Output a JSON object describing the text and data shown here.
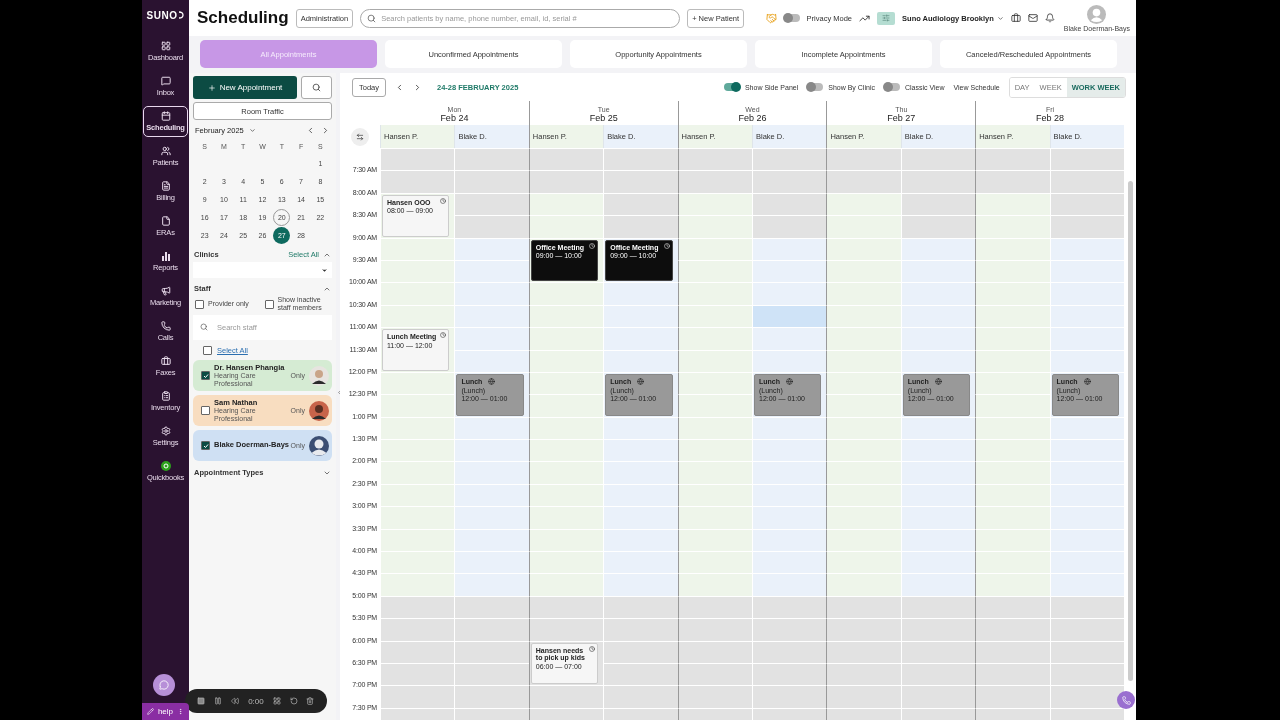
{
  "logo": "SUNO",
  "nav": [
    {
      "label": "Dashboard",
      "selected": false
    },
    {
      "label": "Inbox",
      "selected": false
    },
    {
      "label": "Scheduling",
      "selected": true
    },
    {
      "label": "Patients",
      "selected": false
    },
    {
      "label": "Billing",
      "selected": false
    },
    {
      "label": "ERAs",
      "selected": false
    },
    {
      "label": "Reports",
      "selected": false
    },
    {
      "label": "Marketing",
      "selected": false
    },
    {
      "label": "Calls",
      "selected": false
    },
    {
      "label": "Faxes",
      "selected": false
    },
    {
      "label": "Inventory",
      "selected": false
    },
    {
      "label": "Settings",
      "selected": false
    },
    {
      "label": "Quickbooks",
      "selected": false
    }
  ],
  "help": "help",
  "header": {
    "title": "Scheduling",
    "admin_button": "Administration",
    "search": {
      "placeholder": "Search patients by name, phone number, email, id, serial #"
    },
    "new_patient": "+ New Patient",
    "privacy": {
      "label": "Privacy Mode",
      "on": false
    },
    "clinic": "Suno Audiology Brooklyn",
    "user": "Blake Doerman-Bays"
  },
  "tabs": [
    {
      "label": "All Appointments",
      "selected": true
    },
    {
      "label": "Unconfirmed Appointments",
      "selected": false
    },
    {
      "label": "Opportunity Appointments",
      "selected": false
    },
    {
      "label": "Incomplete Appointments",
      "selected": false
    },
    {
      "label": "Canceled/Rescheduled Appointments",
      "selected": false
    }
  ],
  "side_panel": {
    "new_appointment": "New Appointment",
    "room_traffic": "Room Traffic",
    "mini_calendar": {
      "month": "February 2025",
      "weekdays": [
        "S",
        "M",
        "T",
        "W",
        "T",
        "F",
        "S"
      ],
      "weeks": [
        [
          {
            "label": "1",
            "today": false,
            "selected": false
          }
        ],
        [
          {
            "label": "2",
            "today": false,
            "selected": false
          },
          {
            "label": "3",
            "today": false,
            "selected": false
          },
          {
            "label": "4",
            "today": false,
            "selected": false
          },
          {
            "label": "5",
            "today": false,
            "selected": false
          },
          {
            "label": "6",
            "today": false,
            "selected": false
          },
          {
            "label": "7",
            "today": false,
            "selected": false
          },
          {
            "label": "8",
            "today": false,
            "selected": false
          }
        ],
        [
          {
            "label": "9",
            "today": false,
            "selected": false
          },
          {
            "label": "10",
            "today": false,
            "selected": false
          },
          {
            "label": "11",
            "today": false,
            "selected": false
          },
          {
            "label": "12",
            "today": false,
            "selected": false
          },
          {
            "label": "13",
            "today": false,
            "selected": false
          },
          {
            "label": "14",
            "today": false,
            "selected": false
          },
          {
            "label": "15",
            "today": false,
            "selected": false
          }
        ],
        [
          {
            "label": "16",
            "today": false,
            "selected": false
          },
          {
            "label": "17",
            "today": false,
            "selected": false
          },
          {
            "label": "18",
            "today": false,
            "selected": false
          },
          {
            "label": "19",
            "today": false,
            "selected": false
          },
          {
            "label": "20",
            "today": true,
            "selected": false
          },
          {
            "label": "21",
            "today": false,
            "selected": false
          },
          {
            "label": "22",
            "today": false,
            "selected": false
          }
        ],
        [
          {
            "label": "23",
            "today": false,
            "selected": false
          },
          {
            "label": "24",
            "today": false,
            "selected": false
          },
          {
            "label": "25",
            "today": false,
            "selected": false
          },
          {
            "label": "26",
            "today": false,
            "selected": false
          },
          {
            "label": "27",
            "today": false,
            "selected": true
          },
          {
            "label": "28",
            "today": false,
            "selected": false
          }
        ]
      ]
    },
    "clinics": {
      "label": "Clinics",
      "select_all": "Select All",
      "expanded": true
    },
    "staff": {
      "label": "Staff",
      "expanded": true,
      "filters": [
        {
          "label": "Provider only",
          "checked": false
        },
        {
          "label": "Show inactive staff members",
          "checked": false
        }
      ],
      "search": {
        "placeholder": "Search staff"
      },
      "select_all": {
        "label": "Select All",
        "checked": false
      },
      "members": [
        {
          "name": "Dr. Hansen Phangia",
          "role": "Hearing Care Professional",
          "only": "Only",
          "checked": true,
          "color": "#d5ebd3",
          "avatar": {
            "kind": "photo"
          }
        },
        {
          "name": "Sam Nathan",
          "role": "Hearing Care Professional",
          "only": "Only",
          "checked": false,
          "color": "#f8ddc0",
          "avatar": {
            "kind": "photo"
          }
        },
        {
          "name": "Blake Doerman-Bays",
          "only": "Only",
          "checked": true,
          "color": "#cfe0f3",
          "avatar": {
            "kind": "silhouette"
          }
        }
      ]
    },
    "appointment_types": {
      "label": "Appointment Types",
      "expanded": false
    }
  },
  "calendar": {
    "today": "Today",
    "range": "24-28 FEBRUARY 2025",
    "toggles": [
      {
        "label": "Show Side Panel",
        "on": true
      },
      {
        "label": "Show By Clinic",
        "on": false
      },
      {
        "label": "Classic View",
        "on": false
      }
    ],
    "view_schedule": "View Schedule",
    "views": [
      {
        "label": "DAY",
        "selected": false
      },
      {
        "label": "WEEK",
        "selected": false
      },
      {
        "label": "WORK WEEK",
        "selected": true
      }
    ],
    "days": [
      {
        "weekday": "Mon",
        "date": "Feb 24",
        "providers": [
          {
            "name": "Hansen P.",
            "color": "#eef5ea"
          },
          {
            "name": "Blake D.",
            "color": "#eaf1fa"
          }
        ]
      },
      {
        "weekday": "Tue",
        "date": "Feb 25",
        "providers": [
          {
            "name": "Hansen P.",
            "color": "#eef5ea"
          },
          {
            "name": "Blake D.",
            "color": "#eaf1fa"
          }
        ]
      },
      {
        "weekday": "Wed",
        "date": "Feb 26",
        "providers": [
          {
            "name": "Hansen P.",
            "color": "#eef5ea"
          },
          {
            "name": "Blake D.",
            "color": "#eaf1fa"
          }
        ]
      },
      {
        "weekday": "Thu",
        "date": "Feb 27",
        "providers": [
          {
            "name": "Hansen P.",
            "color": "#eef5ea"
          },
          {
            "name": "Blake D.",
            "color": "#eaf1fa"
          }
        ]
      },
      {
        "weekday": "Fri",
        "date": "Feb 28",
        "providers": [
          {
            "name": "Hansen P.",
            "color": "#eef5ea"
          },
          {
            "name": "Blake D.",
            "color": "#eaf1fa"
          }
        ]
      }
    ],
    "rows": [
      {
        "cells": [
          {
            "kind": "closed"
          },
          {
            "kind": "closed"
          },
          {
            "kind": "closed"
          },
          {
            "kind": "closed"
          },
          {
            "kind": "closed"
          },
          {
            "kind": "closed"
          },
          {
            "kind": "closed"
          },
          {
            "kind": "closed"
          },
          {
            "kind": "closed"
          },
          {
            "kind": "closed"
          }
        ]
      },
      {
        "label": "7:30 AM",
        "cells": [
          {
            "kind": "closed"
          },
          {
            "kind": "closed"
          },
          {
            "kind": "closed"
          },
          {
            "kind": "closed"
          },
          {
            "kind": "closed"
          },
          {
            "kind": "closed"
          },
          {
            "kind": "closed"
          },
          {
            "kind": "closed"
          },
          {
            "kind": "closed"
          },
          {
            "kind": "closed"
          }
        ]
      },
      {
        "label": "8:00 AM",
        "cells": [
          {
            "kind": "open",
            "event": {
              "kind": "light",
              "title": "Hansen OOO",
              "time": "08:00 — 09:00"
            }
          },
          {
            "kind": "closed"
          },
          {
            "kind": "open"
          },
          {
            "kind": "closed"
          },
          {
            "kind": "open"
          },
          {
            "kind": "closed"
          },
          {
            "kind": "open"
          },
          {
            "kind": "closed"
          },
          {
            "kind": "open"
          },
          {
            "kind": "closed"
          }
        ]
      },
      {
        "label": "8:30 AM",
        "cells": [
          {
            "kind": "open"
          },
          {
            "kind": "closed"
          },
          {
            "kind": "open"
          },
          {
            "kind": "closed"
          },
          {
            "kind": "open"
          },
          {
            "kind": "closed"
          },
          {
            "kind": "open"
          },
          {
            "kind": "closed"
          },
          {
            "kind": "open"
          },
          {
            "kind": "closed"
          }
        ]
      },
      {
        "label": "9:00 AM",
        "cells": [
          {
            "kind": "open"
          },
          {
            "kind": "open"
          },
          {
            "kind": "open",
            "event": {
              "kind": "dark",
              "title": "Office Meeting",
              "time": "09:00 — 10:00"
            }
          },
          {
            "kind": "open",
            "event": {
              "kind": "dark",
              "title": "Office Meeting",
              "time": "09:00 — 10:00"
            }
          },
          {
            "kind": "open"
          },
          {
            "kind": "open"
          },
          {
            "kind": "open"
          },
          {
            "kind": "open"
          },
          {
            "kind": "open"
          },
          {
            "kind": "open"
          }
        ]
      },
      {
        "label": "9:30 AM",
        "cells": [
          {
            "kind": "open"
          },
          {
            "kind": "open"
          },
          {
            "kind": "open"
          },
          {
            "kind": "open"
          },
          {
            "kind": "open"
          },
          {
            "kind": "open"
          },
          {
            "kind": "open"
          },
          {
            "kind": "open"
          },
          {
            "kind": "open"
          },
          {
            "kind": "open"
          }
        ]
      },
      {
        "label": "10:00 AM",
        "cells": [
          {
            "kind": "open"
          },
          {
            "kind": "open"
          },
          {
            "kind": "open"
          },
          {
            "kind": "open"
          },
          {
            "kind": "open"
          },
          {
            "kind": "open"
          },
          {
            "kind": "open"
          },
          {
            "kind": "open"
          },
          {
            "kind": "open"
          },
          {
            "kind": "open"
          }
        ]
      },
      {
        "label": "10:30 AM",
        "cells": [
          {
            "kind": "open"
          },
          {
            "kind": "open"
          },
          {
            "kind": "open"
          },
          {
            "kind": "open"
          },
          {
            "kind": "open"
          },
          {
            "kind": "highlight"
          },
          {
            "kind": "open"
          },
          {
            "kind": "open"
          },
          {
            "kind": "open"
          },
          {
            "kind": "open"
          }
        ]
      },
      {
        "label": "11:00 AM",
        "cells": [
          {
            "kind": "open",
            "event": {
              "kind": "light",
              "title": "Lunch Meeting",
              "time": "11:00 — 12:00"
            }
          },
          {
            "kind": "open"
          },
          {
            "kind": "open"
          },
          {
            "kind": "open"
          },
          {
            "kind": "open"
          },
          {
            "kind": "open"
          },
          {
            "kind": "open"
          },
          {
            "kind": "open"
          },
          {
            "kind": "open"
          },
          {
            "kind": "open"
          }
        ]
      },
      {
        "label": "11:30 AM",
        "cells": [
          {
            "kind": "open"
          },
          {
            "kind": "open"
          },
          {
            "kind": "open"
          },
          {
            "kind": "open"
          },
          {
            "kind": "open"
          },
          {
            "kind": "open"
          },
          {
            "kind": "open"
          },
          {
            "kind": "open"
          },
          {
            "kind": "open"
          },
          {
            "kind": "open"
          }
        ]
      },
      {
        "label": "12:00 PM",
        "cells": [
          {
            "kind": "open"
          },
          {
            "kind": "open",
            "event": {
              "kind": "grey",
              "title": "Lunch",
              "subtitle": "(Lunch)",
              "time": "12:00 — 01:00"
            }
          },
          {
            "kind": "open"
          },
          {
            "kind": "open",
            "event": {
              "kind": "grey",
              "title": "Lunch",
              "subtitle": "(Lunch)",
              "time": "12:00 — 01:00"
            }
          },
          {
            "kind": "open"
          },
          {
            "kind": "open",
            "event": {
              "kind": "grey",
              "title": "Lunch",
              "subtitle": "(Lunch)",
              "time": "12:00 — 01:00"
            }
          },
          {
            "kind": "open"
          },
          {
            "kind": "open",
            "event": {
              "kind": "grey",
              "title": "Lunch",
              "subtitle": "(Lunch)",
              "time": "12:00 — 01:00"
            }
          },
          {
            "kind": "open"
          },
          {
            "kind": "open",
            "event": {
              "kind": "grey",
              "title": "Lunch",
              "subtitle": "(Lunch)",
              "time": "12:00 — 01:00"
            }
          }
        ]
      },
      {
        "label": "12:30 PM",
        "cells": [
          {
            "kind": "open"
          },
          {
            "kind": "open"
          },
          {
            "kind": "open"
          },
          {
            "kind": "open"
          },
          {
            "kind": "open"
          },
          {
            "kind": "open"
          },
          {
            "kind": "open"
          },
          {
            "kind": "open"
          },
          {
            "kind": "open"
          },
          {
            "kind": "open"
          }
        ]
      },
      {
        "label": "1:00 PM",
        "cells": [
          {
            "kind": "open"
          },
          {
            "kind": "open"
          },
          {
            "kind": "open"
          },
          {
            "kind": "open"
          },
          {
            "kind": "open"
          },
          {
            "kind": "open"
          },
          {
            "kind": "open"
          },
          {
            "kind": "open"
          },
          {
            "kind": "open"
          },
          {
            "kind": "open"
          }
        ]
      },
      {
        "label": "1:30 PM",
        "cells": [
          {
            "kind": "open"
          },
          {
            "kind": "open"
          },
          {
            "kind": "open"
          },
          {
            "kind": "open"
          },
          {
            "kind": "open"
          },
          {
            "kind": "open"
          },
          {
            "kind": "open"
          },
          {
            "kind": "open"
          },
          {
            "kind": "open"
          },
          {
            "kind": "open"
          }
        ]
      },
      {
        "label": "2:00 PM",
        "cells": [
          {
            "kind": "open"
          },
          {
            "kind": "open"
          },
          {
            "kind": "open"
          },
          {
            "kind": "open"
          },
          {
            "kind": "open"
          },
          {
            "kind": "open"
          },
          {
            "kind": "open"
          },
          {
            "kind": "open"
          },
          {
            "kind": "open"
          },
          {
            "kind": "open"
          }
        ]
      },
      {
        "label": "2:30 PM",
        "cells": [
          {
            "kind": "open"
          },
          {
            "kind": "open"
          },
          {
            "kind": "open"
          },
          {
            "kind": "open"
          },
          {
            "kind": "open"
          },
          {
            "kind": "open"
          },
          {
            "kind": "open"
          },
          {
            "kind": "open"
          },
          {
            "kind": "open"
          },
          {
            "kind": "open"
          }
        ]
      },
      {
        "label": "3:00 PM",
        "cells": [
          {
            "kind": "open"
          },
          {
            "kind": "open"
          },
          {
            "kind": "open"
          },
          {
            "kind": "open"
          },
          {
            "kind": "open"
          },
          {
            "kind": "open"
          },
          {
            "kind": "open"
          },
          {
            "kind": "open"
          },
          {
            "kind": "open"
          },
          {
            "kind": "open"
          }
        ]
      },
      {
        "label": "3:30 PM",
        "cells": [
          {
            "kind": "open"
          },
          {
            "kind": "open"
          },
          {
            "kind": "open"
          },
          {
            "kind": "open"
          },
          {
            "kind": "open"
          },
          {
            "kind": "open"
          },
          {
            "kind": "open"
          },
          {
            "kind": "open"
          },
          {
            "kind": "open"
          },
          {
            "kind": "open"
          }
        ]
      },
      {
        "label": "4:00 PM",
        "cells": [
          {
            "kind": "open"
          },
          {
            "kind": "open"
          },
          {
            "kind": "open"
          },
          {
            "kind": "open"
          },
          {
            "kind": "open"
          },
          {
            "kind": "open"
          },
          {
            "kind": "open"
          },
          {
            "kind": "open"
          },
          {
            "kind": "open"
          },
          {
            "kind": "open"
          }
        ]
      },
      {
        "label": "4:30 PM",
        "cells": [
          {
            "kind": "open"
          },
          {
            "kind": "open"
          },
          {
            "kind": "open"
          },
          {
            "kind": "open"
          },
          {
            "kind": "open"
          },
          {
            "kind": "open"
          },
          {
            "kind": "open"
          },
          {
            "kind": "open"
          },
          {
            "kind": "open"
          },
          {
            "kind": "open"
          }
        ]
      },
      {
        "label": "5:00 PM",
        "cells": [
          {
            "kind": "closed"
          },
          {
            "kind": "closed"
          },
          {
            "kind": "closed"
          },
          {
            "kind": "closed"
          },
          {
            "kind": "closed"
          },
          {
            "kind": "closed"
          },
          {
            "kind": "closed"
          },
          {
            "kind": "closed"
          },
          {
            "kind": "closed"
          },
          {
            "kind": "closed"
          }
        ]
      },
      {
        "label": "5:30 PM",
        "cells": [
          {
            "kind": "closed"
          },
          {
            "kind": "closed"
          },
          {
            "kind": "closed"
          },
          {
            "kind": "closed"
          },
          {
            "kind": "closed"
          },
          {
            "kind": "closed"
          },
          {
            "kind": "closed"
          },
          {
            "kind": "closed"
          },
          {
            "kind": "closed"
          },
          {
            "kind": "closed"
          }
        ]
      },
      {
        "label": "6:00 PM",
        "cells": [
          {
            "kind": "closed"
          },
          {
            "kind": "closed"
          },
          {
            "kind": "closed",
            "event": {
              "kind": "light",
              "title": "Hansen needs to pick up kids",
              "time": "06:00 — 07:00"
            }
          },
          {
            "kind": "closed"
          },
          {
            "kind": "closed"
          },
          {
            "kind": "closed"
          },
          {
            "kind": "closed"
          },
          {
            "kind": "closed"
          },
          {
            "kind": "closed"
          },
          {
            "kind": "closed"
          }
        ]
      },
      {
        "label": "6:30 PM",
        "cells": [
          {
            "kind": "closed"
          },
          {
            "kind": "closed"
          },
          {
            "kind": "closed"
          },
          {
            "kind": "closed"
          },
          {
            "kind": "closed"
          },
          {
            "kind": "closed"
          },
          {
            "kind": "closed"
          },
          {
            "kind": "closed"
          },
          {
            "kind": "closed"
          },
          {
            "kind": "closed"
          }
        ]
      },
      {
        "label": "7:00 PM",
        "cells": [
          {
            "kind": "closed"
          },
          {
            "kind": "closed"
          },
          {
            "kind": "closed"
          },
          {
            "kind": "closed"
          },
          {
            "kind": "closed"
          },
          {
            "kind": "closed"
          },
          {
            "kind": "closed"
          },
          {
            "kind": "closed"
          },
          {
            "kind": "closed"
          },
          {
            "kind": "closed"
          }
        ]
      },
      {
        "label": "7:30 PM",
        "cells": [
          {
            "kind": "closed"
          },
          {
            "kind": "closed"
          },
          {
            "kind": "closed"
          },
          {
            "kind": "closed"
          },
          {
            "kind": "closed"
          },
          {
            "kind": "closed"
          },
          {
            "kind": "closed"
          },
          {
            "kind": "closed"
          },
          {
            "kind": "closed"
          },
          {
            "kind": "closed"
          }
        ]
      }
    ]
  },
  "recorder": {
    "time": "0:00"
  }
}
